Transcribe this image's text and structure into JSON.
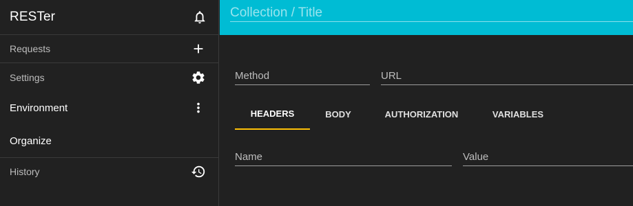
{
  "app": {
    "title": "RESTer"
  },
  "sidebar": {
    "requests": {
      "label": "Requests"
    },
    "settings": {
      "label": "Settings"
    },
    "environment": {
      "label": "Environment"
    },
    "organize": {
      "label": "Organize"
    },
    "history": {
      "label": "History"
    }
  },
  "header": {
    "title_placeholder": "Collection / Title",
    "title_value": ""
  },
  "request": {
    "method_placeholder": "Method",
    "url_placeholder": "URL",
    "tabs": [
      {
        "label": "HEADERS",
        "active": true
      },
      {
        "label": "BODY",
        "active": false
      },
      {
        "label": "AUTHORIZATION",
        "active": false
      },
      {
        "label": "VARIABLES",
        "active": false
      }
    ],
    "headers": {
      "name_placeholder": "Name",
      "value_placeholder": "Value"
    }
  },
  "colors": {
    "accent": "#00bcd4",
    "tab_indicator": "#ffc107",
    "background": "#212121"
  },
  "icons": [
    "bell-icon",
    "plus-icon",
    "gear-icon",
    "more-vert-icon",
    "history-icon"
  ]
}
